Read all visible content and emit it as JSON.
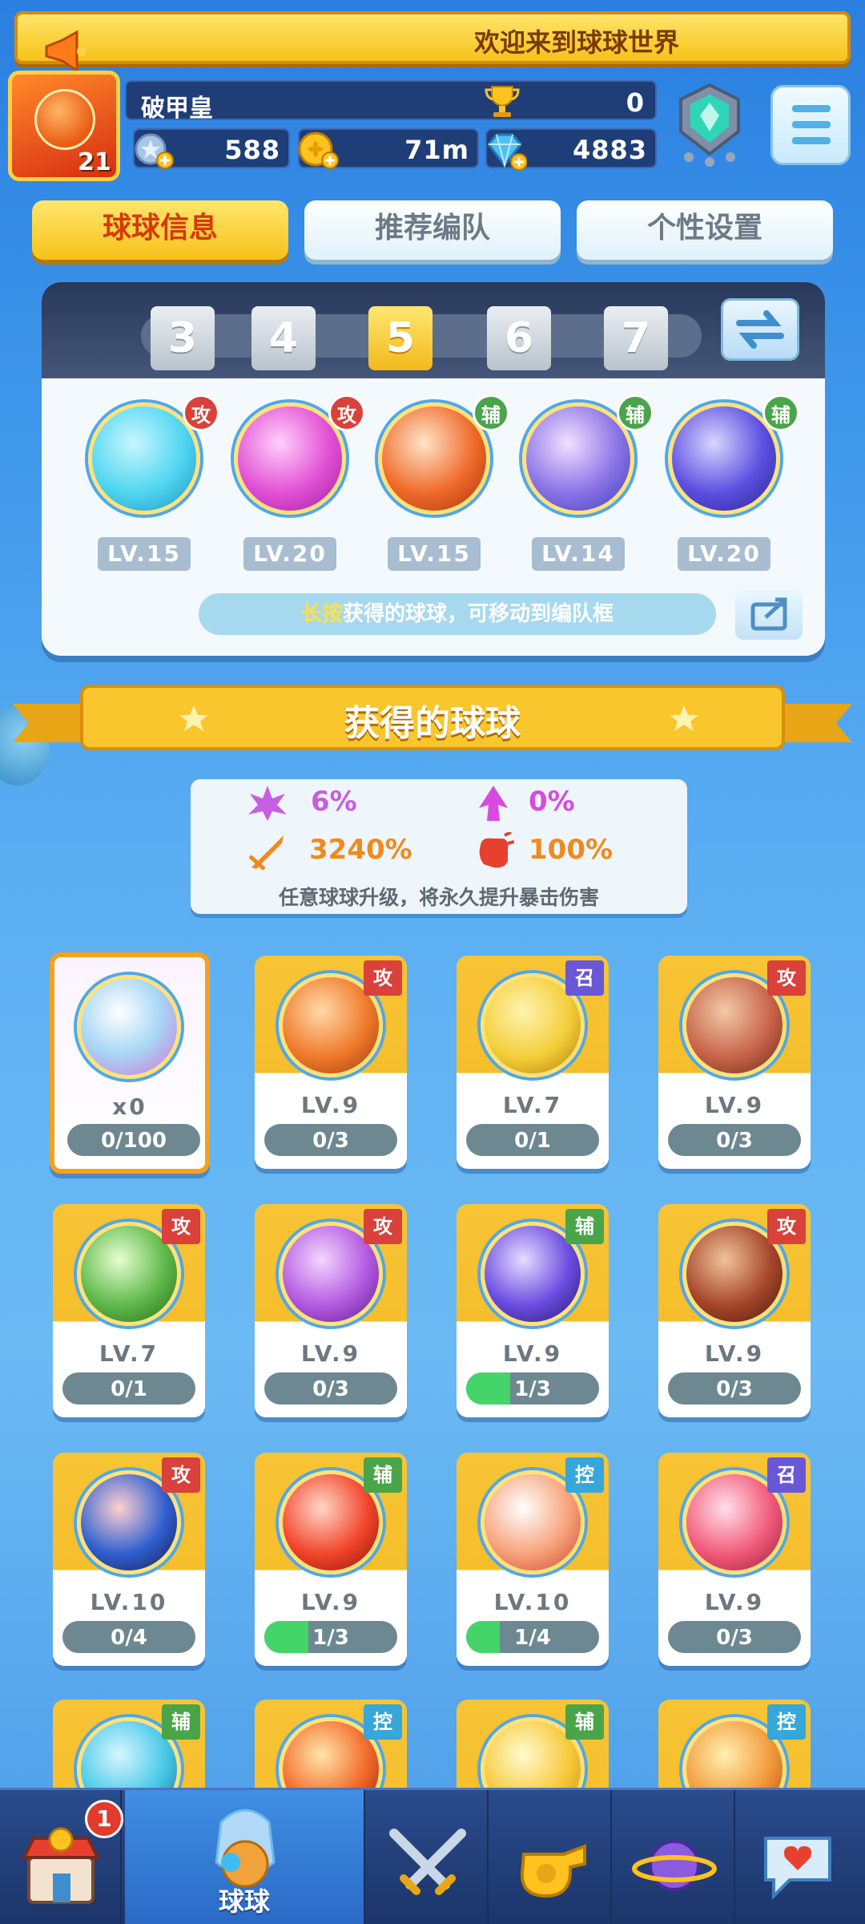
{
  "marquee": {
    "text": "欢迎来到球球世界"
  },
  "profile": {
    "avatar_level": "21",
    "name": "破甲皇",
    "trophies": "0",
    "resources": [
      {
        "icon": "star-plus-icon",
        "value": "588"
      },
      {
        "icon": "clover-coin-icon",
        "value": "71m"
      },
      {
        "icon": "diamond-icon",
        "value": "4883"
      }
    ]
  },
  "tabs": [
    {
      "label": "球球信息",
      "active": true
    },
    {
      "label": "推荐编队",
      "active": false
    },
    {
      "label": "个性设置",
      "active": false
    }
  ],
  "team": {
    "slots": [
      "3",
      "4",
      "5",
      "6",
      "7"
    ],
    "active_slot": "5",
    "balls": [
      {
        "level": "LV.15",
        "type": "攻",
        "color": "#4fd6f0"
      },
      {
        "level": "LV.20",
        "type": "攻",
        "color": "#e14fd4"
      },
      {
        "level": "LV.15",
        "type": "辅",
        "color": "#ef6a2a"
      },
      {
        "level": "LV.14",
        "type": "辅",
        "color": "#8a73e6"
      },
      {
        "level": "LV.20",
        "type": "辅",
        "color": "#5b4fe0"
      }
    ],
    "hint_key": "长按",
    "hint_text": "获得的球球，可移动到编队框"
  },
  "section_title": "获得的球球",
  "stats": {
    "items": [
      {
        "icon": "purple-burst-icon",
        "value": "6%",
        "color": "#c85ee0"
      },
      {
        "icon": "pink-arrow-icon",
        "value": "0%",
        "color": "#d94ae0"
      },
      {
        "icon": "orange-sword-icon",
        "value": "3240%",
        "color": "#f08a1e"
      },
      {
        "icon": "red-fist-icon",
        "value": "100%",
        "color": "#f08a1e"
      }
    ],
    "note": "任意球球升级，将永久提升暴击伤害"
  },
  "cards": [
    {
      "kind": "special",
      "level": "x0",
      "progress": "0/100",
      "fill": 0,
      "badge": "",
      "color": "#a7d6f5"
    },
    {
      "level": "LV.9",
      "progress": "0/3",
      "fill": 0,
      "badge": "攻",
      "btype": "atk",
      "color": "#f07a2a"
    },
    {
      "level": "LV.7",
      "progress": "0/1",
      "fill": 0,
      "badge": "召",
      "btype": "sum",
      "color": "#f4cf3a"
    },
    {
      "level": "LV.9",
      "progress": "0/3",
      "fill": 0,
      "badge": "攻",
      "btype": "atk",
      "color": "#c8644a"
    },
    {
      "level": "LV.7",
      "progress": "0/1",
      "fill": 0,
      "badge": "攻",
      "btype": "atk",
      "color": "#5db84a"
    },
    {
      "level": "LV.9",
      "progress": "0/3",
      "fill": 0,
      "badge": "攻",
      "btype": "atk",
      "color": "#b35ae0"
    },
    {
      "level": "LV.9",
      "progress": "1/3",
      "fill": 0.33,
      "badge": "辅",
      "btype": "sup",
      "color": "#6a4ce0"
    },
    {
      "level": "LV.9",
      "progress": "0/3",
      "fill": 0,
      "badge": "攻",
      "btype": "atk",
      "color": "#a5462a"
    },
    {
      "level": "LV.10",
      "progress": "0/4",
      "fill": 0,
      "badge": "攻",
      "btype": "atk",
      "color": "#2f5fd0"
    },
    {
      "level": "LV.9",
      "progress": "1/3",
      "fill": 0.33,
      "badge": "辅",
      "btype": "sup",
      "color": "#f2452a"
    },
    {
      "level": "LV.10",
      "progress": "1/4",
      "fill": 0.25,
      "badge": "控",
      "btype": "ctl",
      "color": "#f7a27a"
    },
    {
      "level": "LV.9",
      "progress": "0/3",
      "fill": 0,
      "badge": "召",
      "btype": "sum",
      "color": "#f25a7a"
    },
    {
      "level": "",
      "progress": "",
      "fill": 0,
      "badge": "辅",
      "btype": "sup",
      "color": "#47c9e8"
    },
    {
      "level": "",
      "progress": "",
      "fill": 0,
      "badge": "控",
      "btype": "ctl",
      "color": "#f26a2a"
    },
    {
      "level": "",
      "progress": "",
      "fill": 0,
      "badge": "辅",
      "btype": "sup",
      "color": "#f7c93a"
    },
    {
      "level": "",
      "progress": "",
      "fill": 0,
      "badge": "控",
      "btype": "ctl",
      "color": "#f29a3a"
    }
  ],
  "nav": {
    "items": [
      {
        "icon": "shop-icon",
        "label": "",
        "badge": "1"
      },
      {
        "icon": "ball-icon",
        "label": "球球",
        "active": true
      },
      {
        "icon": "crossed-swords-icon",
        "label": ""
      },
      {
        "icon": "whistle-icon",
        "label": ""
      },
      {
        "icon": "planet-icon",
        "label": ""
      },
      {
        "icon": "chat-heart-icon",
        "label": ""
      }
    ]
  }
}
